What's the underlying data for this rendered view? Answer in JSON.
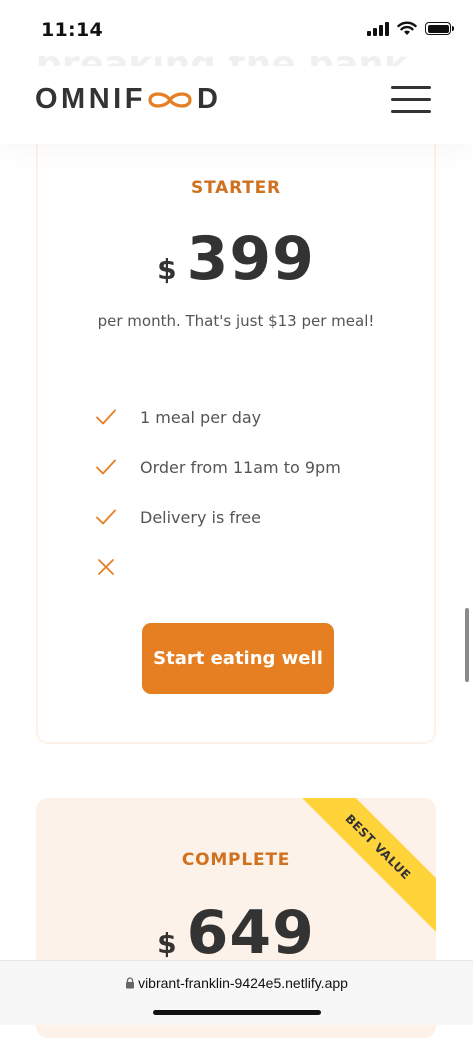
{
  "status_bar": {
    "time": "11:14",
    "signal_icon": "cellular-signal-icon",
    "wifi_icon": "wifi-icon",
    "battery_icon": "battery-icon"
  },
  "header": {
    "ghost_heading": "breaking the bank",
    "logo_prefix": "OMNIF",
    "logo_suffix": "D",
    "logo_icon": "infinity-logo-icon",
    "menu_icon": "hamburger-menu-icon",
    "accent_color": "#e67e22"
  },
  "plans": {
    "starter": {
      "name": "STARTER",
      "currency": "$",
      "price": "399",
      "note": "per month. That's just $13 per meal!",
      "features": [
        {
          "text": "1 meal per day",
          "icon": "checkmark-icon"
        },
        {
          "text": "Order from 11am to 9pm",
          "icon": "checkmark-icon"
        },
        {
          "text": "Delivery is free",
          "icon": "checkmark-icon"
        },
        {
          "text": "",
          "icon": "close-icon"
        }
      ],
      "cta": "Start eating well"
    },
    "complete": {
      "name": "COMPLETE",
      "currency": "$",
      "price": "649",
      "ribbon": "BEST VALUE",
      "ribbon_color": "#ffd43b"
    }
  },
  "browser": {
    "url": "vibrant-franklin-9424e5.netlify.app",
    "lock_icon": "lock-icon"
  }
}
